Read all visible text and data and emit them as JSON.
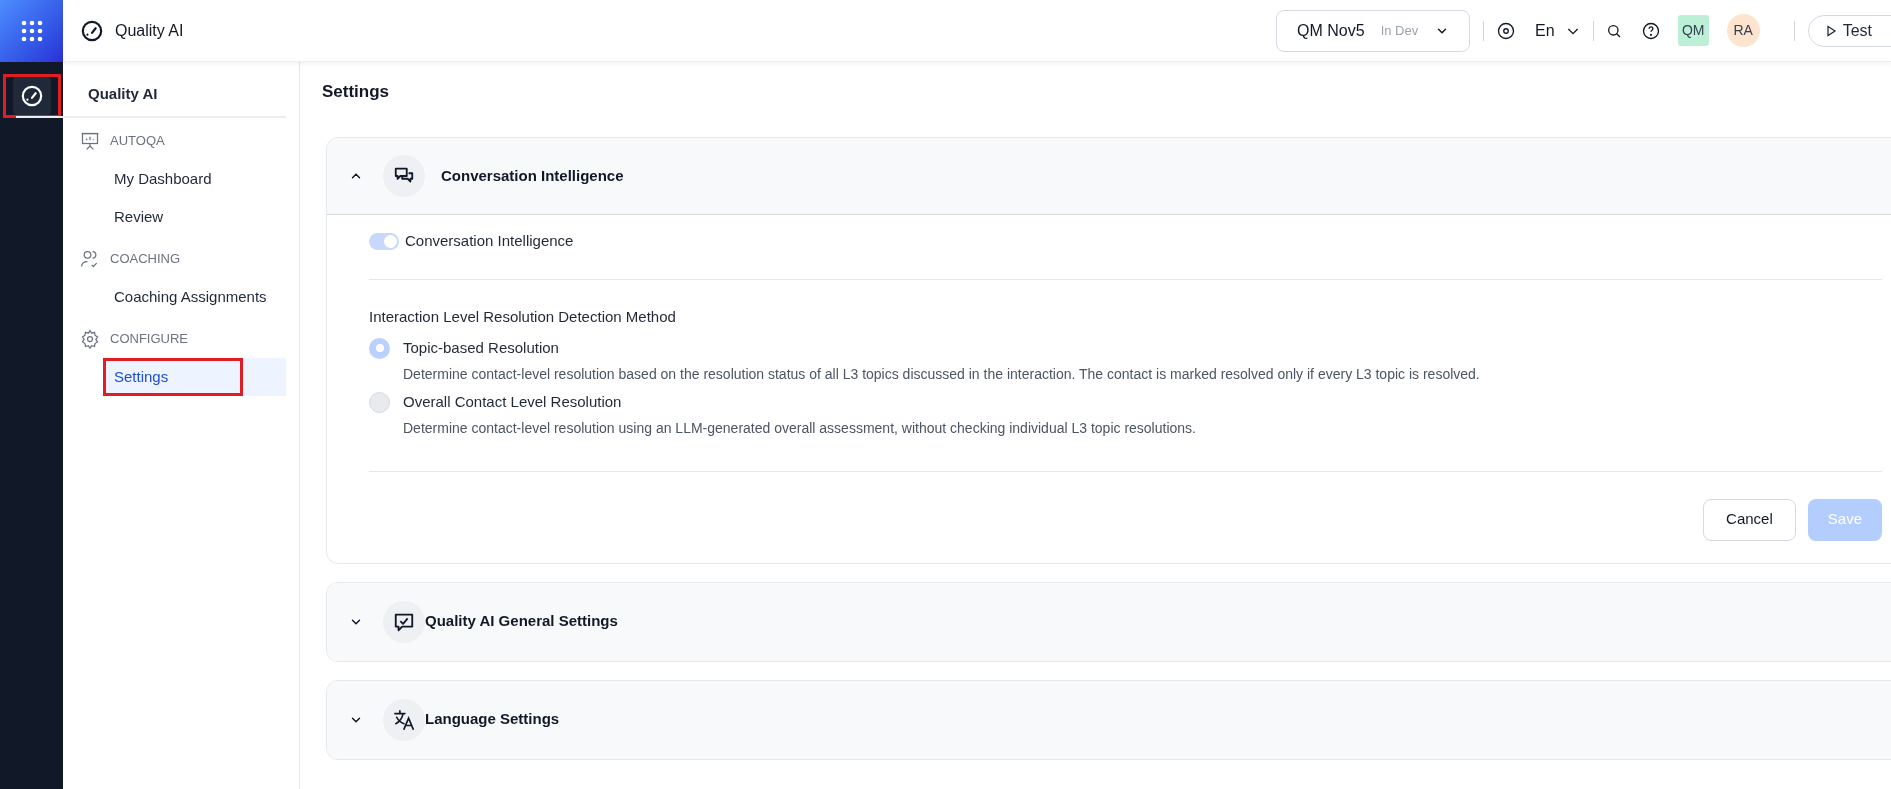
{
  "rail": {
    "items": [
      {
        "kind": "apps"
      },
      {
        "kind": "gauge",
        "selected": true,
        "highlighted": true
      }
    ]
  },
  "header": {
    "title": "Quality AI",
    "workspace": {
      "name": "QM Nov5",
      "env": "In Dev"
    },
    "language": "En",
    "avatars": [
      {
        "initials": "QM",
        "kind": "square",
        "color": "#bbf0d6"
      },
      {
        "initials": "RA",
        "kind": "circle",
        "color": "#fde4cf"
      }
    ],
    "test_button": "Test"
  },
  "sidebar": {
    "title": "Quality AI",
    "sections": [
      {
        "kind": "presentation",
        "label": "AUTOQA",
        "items": [
          {
            "label": "My Dashboard",
            "selected": false,
            "highlighted": false
          },
          {
            "label": "Review",
            "selected": false,
            "highlighted": false
          }
        ]
      },
      {
        "kind": "people",
        "label": "COACHING",
        "items": [
          {
            "label": "Coaching Assignments",
            "selected": false,
            "highlighted": false
          }
        ]
      },
      {
        "kind": "gear",
        "label": "CONFIGURE",
        "items": [
          {
            "label": "Settings",
            "selected": true,
            "highlighted": true
          }
        ]
      }
    ]
  },
  "main": {
    "title": "Settings",
    "panels": [
      {
        "title": "Conversation Intelligence",
        "kind": "chat",
        "expanded": true,
        "toggle": {
          "label": "Conversation Intelligence",
          "on": true,
          "disabled": true
        },
        "method": {
          "label": "Interaction Level Resolution Detection Method",
          "options": [
            {
              "label": "Topic-based Resolution",
              "description": "Determine contact-level resolution based on the resolution status of all L3 topics discussed in the interaction. The contact is marked resolved only if every L3 topic is resolved.",
              "selected": true
            },
            {
              "label": "Overall Contact Level Resolution",
              "description": "Determine contact-level resolution using an LLM-generated overall assessment, without checking individual L3 topic resolutions.",
              "selected": false
            }
          ]
        },
        "buttons": [
          {
            "label": "Cancel",
            "kind": "secondary",
            "disabled": false
          },
          {
            "label": "Save",
            "kind": "primary",
            "disabled": true
          }
        ]
      },
      {
        "title": "Quality AI General Settings",
        "kind": "check-chat",
        "expanded": false
      },
      {
        "title": "Language Settings",
        "kind": "translate",
        "expanded": false
      }
    ]
  }
}
